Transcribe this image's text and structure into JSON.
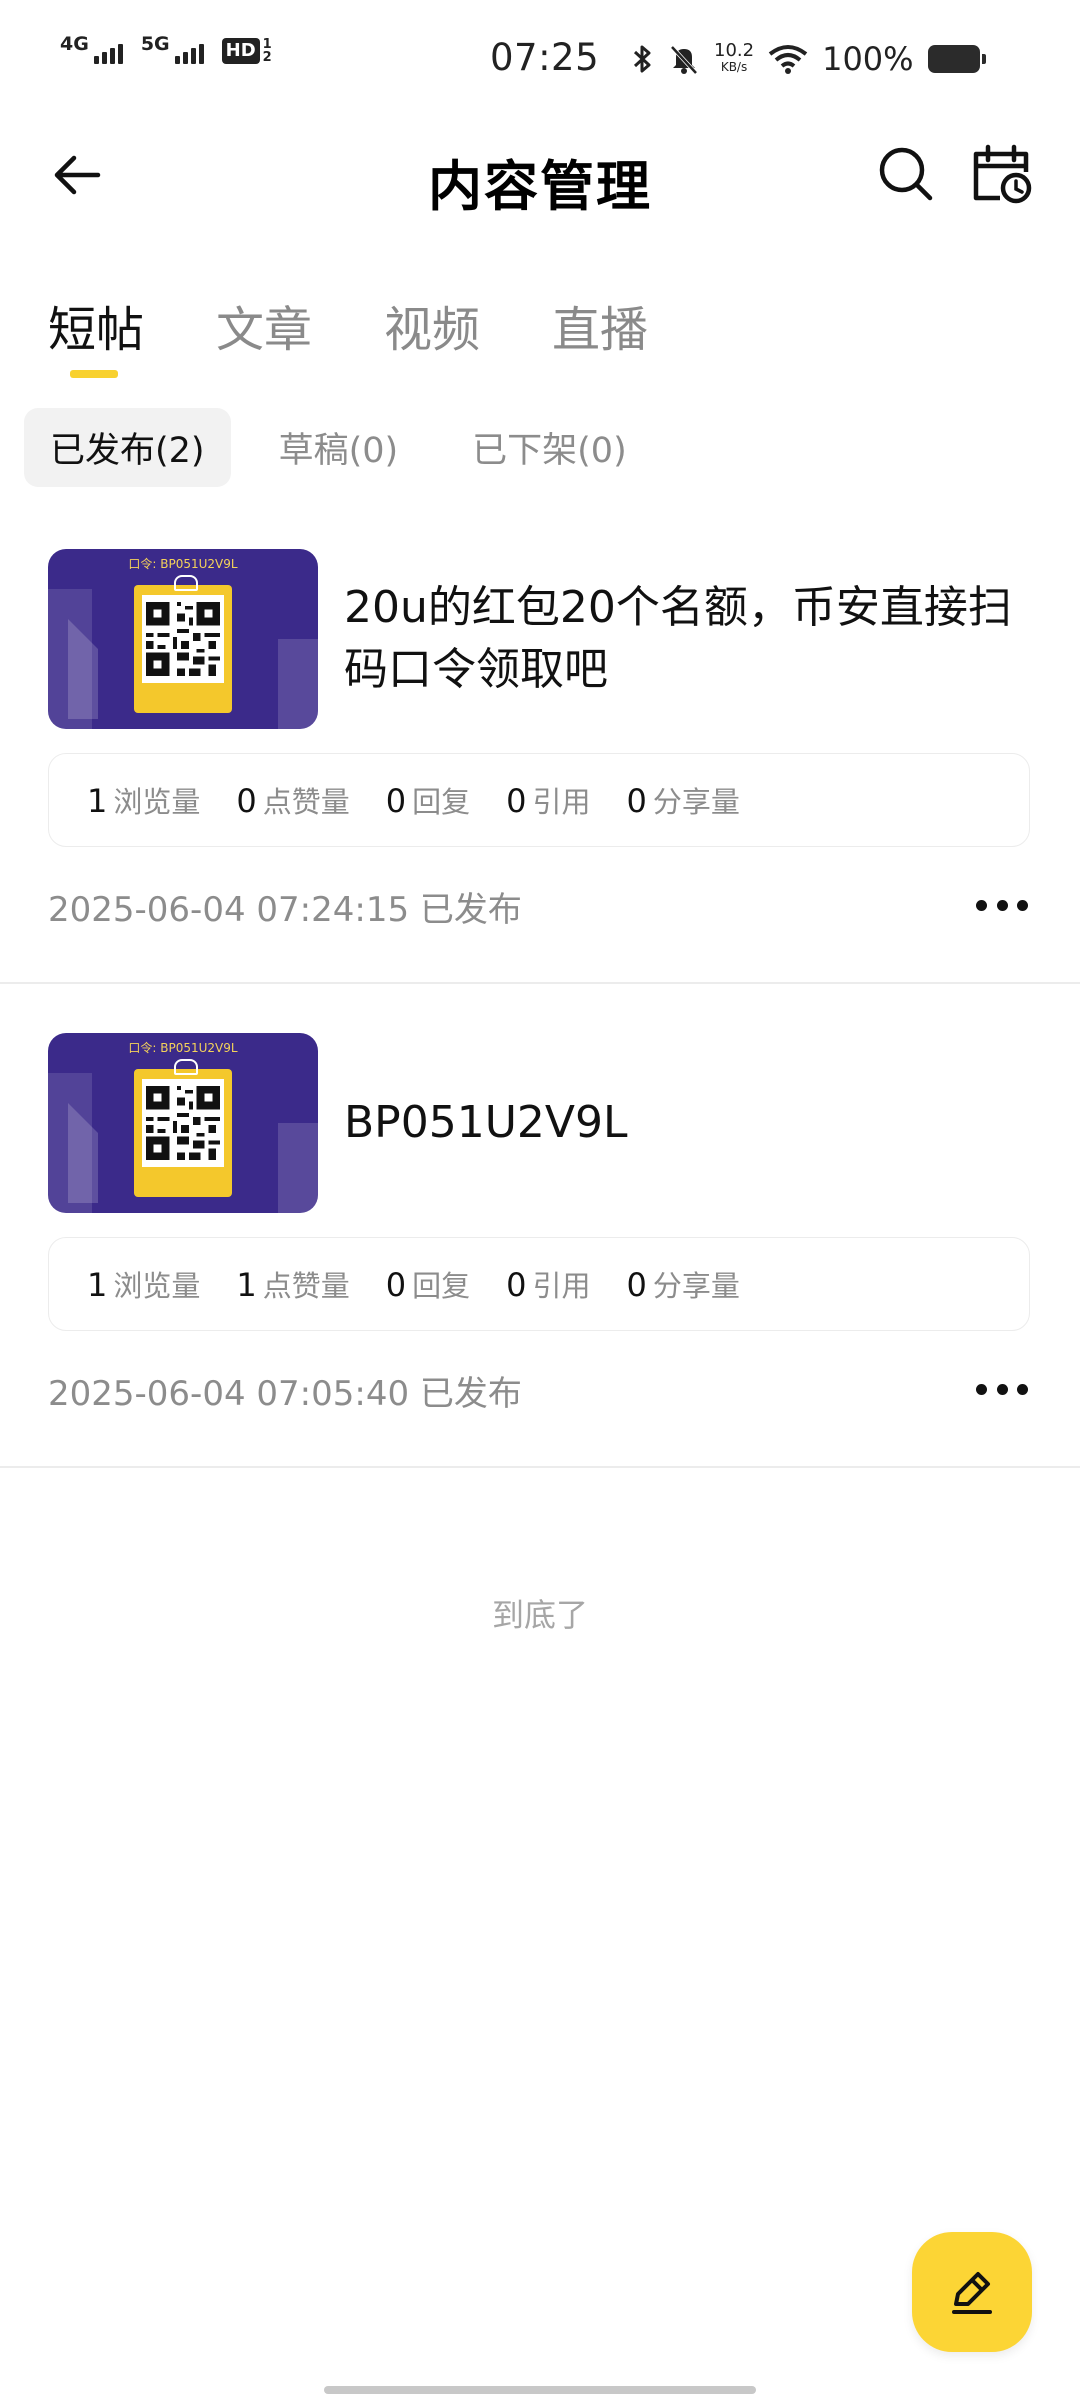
{
  "status_bar": {
    "network1": "4G",
    "network2": "5G",
    "hd_label": "HD",
    "hd_sup": "1",
    "hd_sub": "2",
    "time": "07:25",
    "speed_value": "10.2",
    "speed_unit": "KB/s",
    "battery_percent": "100%"
  },
  "header": {
    "title": "内容管理"
  },
  "tabs": [
    {
      "label": "短帖",
      "active": true
    },
    {
      "label": "文章",
      "active": false
    },
    {
      "label": "视频",
      "active": false
    },
    {
      "label": "直播",
      "active": false
    }
  ],
  "subtabs": [
    {
      "label": "已发布(2)",
      "active": true
    },
    {
      "label": "草稿(0)",
      "active": false
    },
    {
      "label": "已下架(0)",
      "active": false
    }
  ],
  "posts": [
    {
      "thumb_code": "口令: BP051U2V9L",
      "title": "20u的红包20个名额，币安直接扫码口令领取吧",
      "stats": [
        {
          "num": "1",
          "label": "浏览量"
        },
        {
          "num": "0",
          "label": "点赞量"
        },
        {
          "num": "0",
          "label": "回复"
        },
        {
          "num": "0",
          "label": "引用"
        },
        {
          "num": "0",
          "label": "分享量"
        }
      ],
      "meta": "2025-06-04 07:24:15 已发布"
    },
    {
      "thumb_code": "口令: BP051U2V9L",
      "title": "BP051U2V9L",
      "stats": [
        {
          "num": "1",
          "label": "浏览量"
        },
        {
          "num": "1",
          "label": "点赞量"
        },
        {
          "num": "0",
          "label": "回复"
        },
        {
          "num": "0",
          "label": "引用"
        },
        {
          "num": "0",
          "label": "分享量"
        }
      ],
      "meta": "2025-06-04 07:05:40 已发布"
    }
  ],
  "footer": {
    "end_text": "到底了"
  },
  "colors": {
    "accent": "#FCD535",
    "tab_indicator": "#F8D12F",
    "thumb_bg": "#3b2a8a"
  },
  "icons": {
    "back": "arrow-left-icon",
    "search": "search-icon",
    "calendar": "calendar-clock-icon",
    "more": "more-dots-icon",
    "compose": "pencil-icon"
  }
}
